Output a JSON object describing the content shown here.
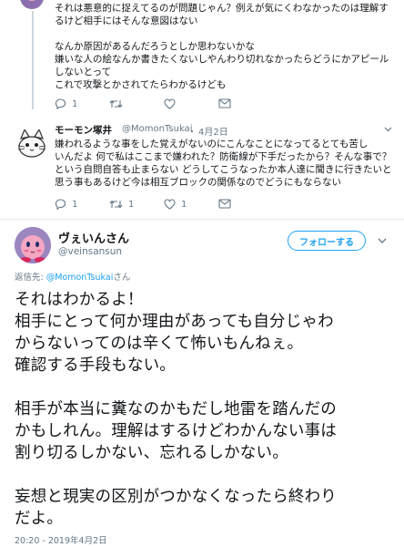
{
  "thread": {
    "prev_reply": {
      "lines": [
        "それは悪意的に捉えてるのが問題じゃん？例えが気にくわなかったのは理解す",
        "るけど相手にはそんな意図はない",
        "",
        "なんか原因があるんだろうとしか思わないかな",
        "嫌いな人の絵なんか書きたくないしやんわり切れなかったらどうにかアピール",
        "しないとって",
        "これで攻撃とかされてたらわかるけども"
      ],
      "actions": {
        "reply": "1",
        "retweet": "",
        "like": ""
      }
    },
    "mention_reply": {
      "name": "モーモン塚井",
      "handle": "@MomonTsukai",
      "date_sep": "・",
      "date": "4月2日",
      "lines": [
        "嫌われるような事をした覚えがないのにこんなことになってるとても苦し",
        "いんだよ 何で私はここまで嫌われた？防衛線が下手だったから？そんな事で？",
        "という自問自答も止まらない どうしてこうなったか本人達に聞きに行きたいと",
        "思う事もあるけど今は相互ブロックの関係なのでどうにもならない"
      ],
      "actions": {
        "reply": "1",
        "retweet": "1",
        "like": "1"
      }
    }
  },
  "main_tweet": {
    "name": "ヴぇいんさん",
    "handle": "@veinsansun",
    "follow_label": "フォローする",
    "reply_to_prefix": "返信先: ",
    "reply_to_handle": "@MomonTsukai",
    "reply_to_suffix": "さん",
    "body_lines": [
      "それはわかるよ！",
      "相手にとって何か理由があっても自分じゃわ",
      "からないってのは辛くて怖いもんねぇ。",
      "確認する手段もない。",
      "",
      "相手が本当に糞なのかもだし地雷を踏んだの",
      "かもしれん。理解はするけどわかんない事は",
      "割り切るしかない、忘れるしかない。",
      "",
      "妄想と現実の区別がつかなくなったら終わり",
      "だよ。"
    ],
    "timestamp": "20:20 - 2019年4月2日"
  },
  "icons": {
    "reply": "reply-icon",
    "retweet": "retweet-icon",
    "like": "heart-icon",
    "dm": "mail-icon",
    "more": "chevron-down-icon"
  },
  "colors": {
    "accent": "#1da1f2",
    "muted": "#657786",
    "text": "#14171a",
    "thread_line": "#ccd6dd",
    "avatar_bg": "#8b6fae"
  }
}
